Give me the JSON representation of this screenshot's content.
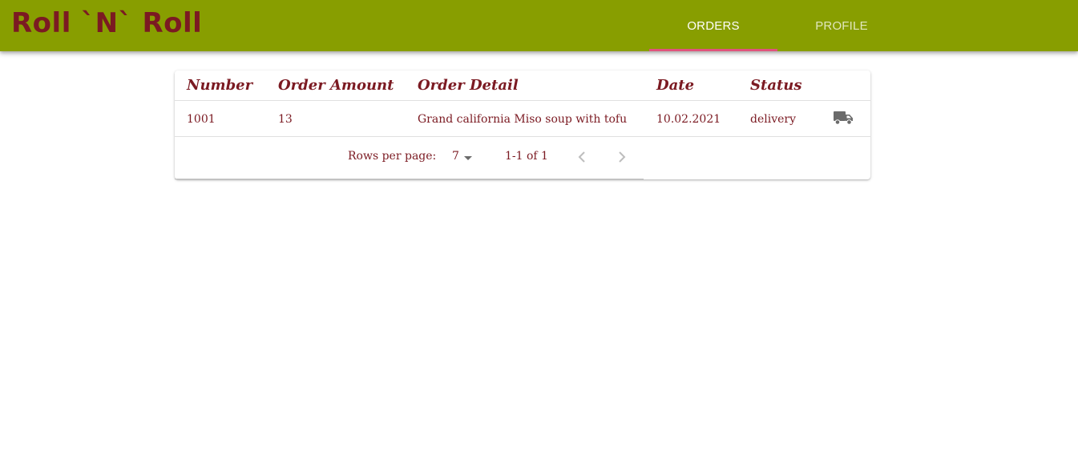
{
  "app": {
    "brand": "Roll `N` Roll"
  },
  "nav": {
    "tabs": [
      {
        "label": "ORDERS",
        "active": true
      },
      {
        "label": "PROFILE",
        "active": false
      }
    ]
  },
  "orders_table": {
    "columns": [
      "Number",
      "Order Amount",
      "Order Detail",
      "Date",
      "Status"
    ],
    "rows": [
      {
        "number": "1001",
        "amount": "13",
        "detail": "Grand california Miso soup with tofu",
        "date": "10.02.2021",
        "status": "delivery",
        "status_icon": "truck-icon"
      }
    ],
    "pagination": {
      "rows_per_page_label": "Rows per page:",
      "rows_per_page_value": "7",
      "range_text": "1-1 of 1"
    }
  },
  "colors": {
    "appbar": "#889e00",
    "brand_text": "#7b1a22",
    "tab_indicator": "#e0537c",
    "table_text": "#7b1a22"
  }
}
